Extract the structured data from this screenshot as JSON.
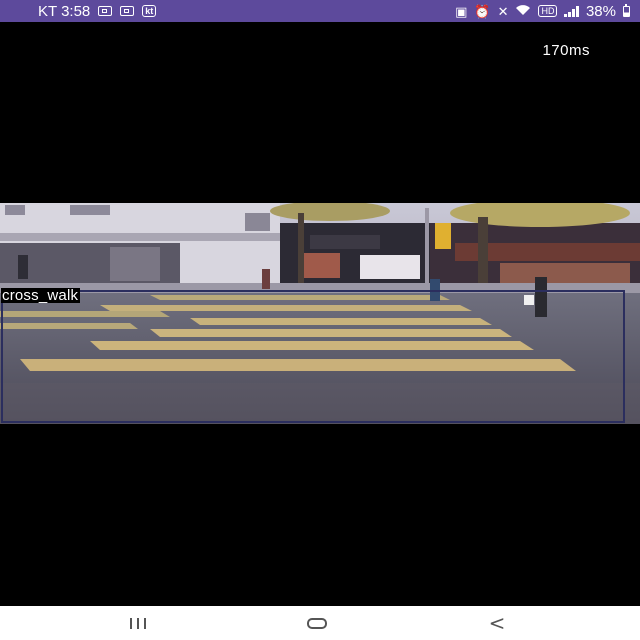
{
  "status_bar": {
    "carrier_time": "KT 3:58",
    "notification_icons": [
      "screenshot-icon",
      "screenshot-icon",
      "kt-app-icon"
    ],
    "kt_badge": "kt",
    "hd_badge": "HD",
    "battery": "38%",
    "background_color": "#5d4a9c"
  },
  "inference": {
    "latency": "170ms"
  },
  "detection": {
    "label": "cross_walk",
    "box_color": "#2b2e5e"
  },
  "nav_bar": {
    "buttons": [
      "recents-button",
      "home-button",
      "back-button"
    ]
  }
}
